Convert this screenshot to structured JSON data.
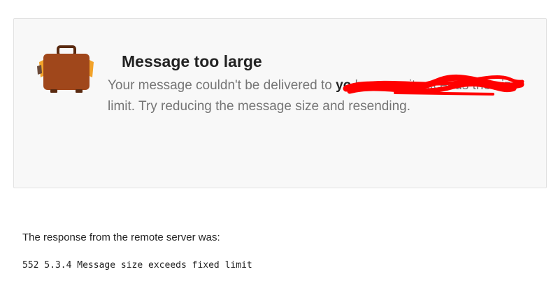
{
  "notice": {
    "title": "Message too large",
    "message_before": "Your message couldn't be delivered to ",
    "recipient": "yo",
    "message_after": " because it exceeds the size limit. Try reducing the message size and resending.",
    "icon": "suitcase-icon"
  },
  "response": {
    "label": "The response from the remote server was:",
    "code": "552 5.3.4 Message size exceeds fixed limit"
  },
  "colors": {
    "card_background": "#f8f8f8",
    "suitcase_body": "#a0471b",
    "suitcase_strap": "#f2a32a",
    "redaction": "#ff0000"
  }
}
